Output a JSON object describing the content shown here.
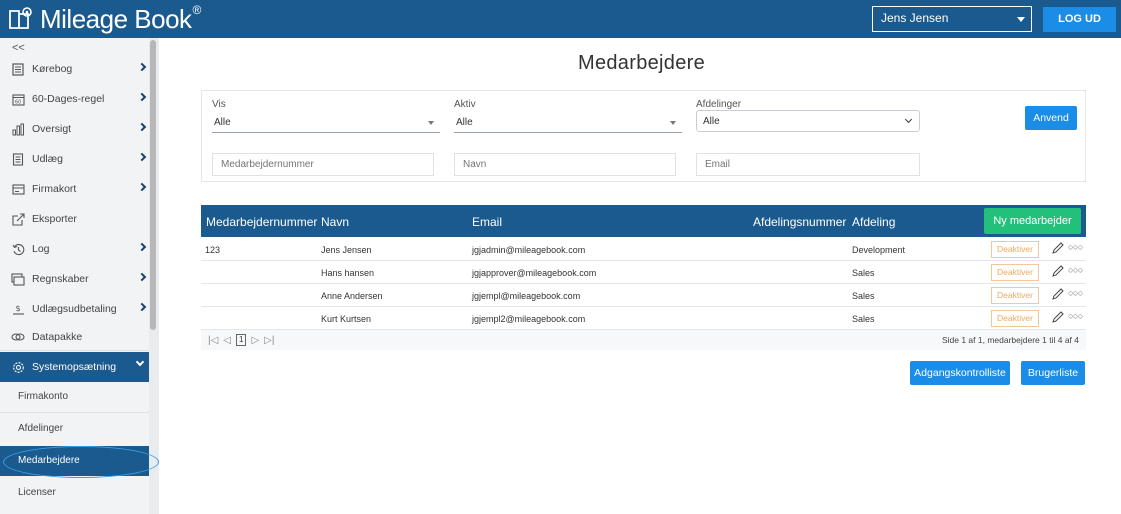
{
  "app": {
    "brand": "Mileage Book",
    "brand_mark": "®",
    "user": "Jens Jensen",
    "logout": "LOG UD"
  },
  "sidebar": {
    "collapse": "<<",
    "items": [
      {
        "label": "Kørebog",
        "icon": "logbook-icon"
      },
      {
        "label": "60-Dages-regel",
        "icon": "calendar-60-icon"
      },
      {
        "label": "Oversigt",
        "icon": "bar-chart-icon"
      },
      {
        "label": "Udlæg",
        "icon": "receipt-icon"
      },
      {
        "label": "Firmakort",
        "icon": "card-icon"
      },
      {
        "label": "Eksporter",
        "icon": "export-icon"
      },
      {
        "label": "Log",
        "icon": "history-icon"
      },
      {
        "label": "Regnskaber",
        "icon": "accounts-icon"
      },
      {
        "label": "Udlægsudbetaling",
        "icon": "payout-icon"
      },
      {
        "label": "Datapakke",
        "icon": "data-package-icon"
      },
      {
        "label": "Systemopsætning",
        "icon": "gear-icon"
      }
    ],
    "subitems": [
      "Firmakonto",
      "Afdelinger",
      "Medarbejdere",
      "Licenser"
    ]
  },
  "main": {
    "title": "Medarbejdere",
    "filters": {
      "vis_label": "Vis",
      "vis_value": "Alle",
      "aktiv_label": "Aktiv",
      "aktiv_value": "Alle",
      "afd_label": "Afdelinger",
      "afd_value": "Alle",
      "apply": "Anvend",
      "ph_number": "Medarbejdernummer",
      "ph_name": "Navn",
      "ph_email": "Email"
    },
    "table": {
      "headers": [
        "Medarbejdernummer",
        "Navn",
        "Email",
        "Afdelingsnummer",
        "Afdeling"
      ],
      "new_button": "Ny medarbejder",
      "deactivate": "Deaktiver",
      "rows": [
        {
          "number": "123",
          "name": "Jens Jensen",
          "email": "jgjadmin@mileagebook.com",
          "dept_no": "",
          "dept": "Development"
        },
        {
          "number": "",
          "name": "Hans hansen",
          "email": "jgjapprover@mileagebook.com",
          "dept_no": "",
          "dept": "Sales"
        },
        {
          "number": "",
          "name": "Anne Andersen",
          "email": "jgjempl@mileagebook.com",
          "dept_no": "",
          "dept": "Sales"
        },
        {
          "number": "",
          "name": "Kurt Kurtsen",
          "email": "jgjempl2@mileagebook.com",
          "dept_no": "",
          "dept": "Sales"
        }
      ],
      "page": "1",
      "pager_info": "Side 1 af 1, medarbejdere 1 til 4 af 4"
    },
    "buttons": {
      "access_list": "Adgangskontrolliste",
      "user_list": "Brugerliste"
    }
  },
  "colors": {
    "primary": "#1a5a8e",
    "accent": "#1b8de6",
    "success": "#22c07a",
    "warning": "#f0a860"
  }
}
